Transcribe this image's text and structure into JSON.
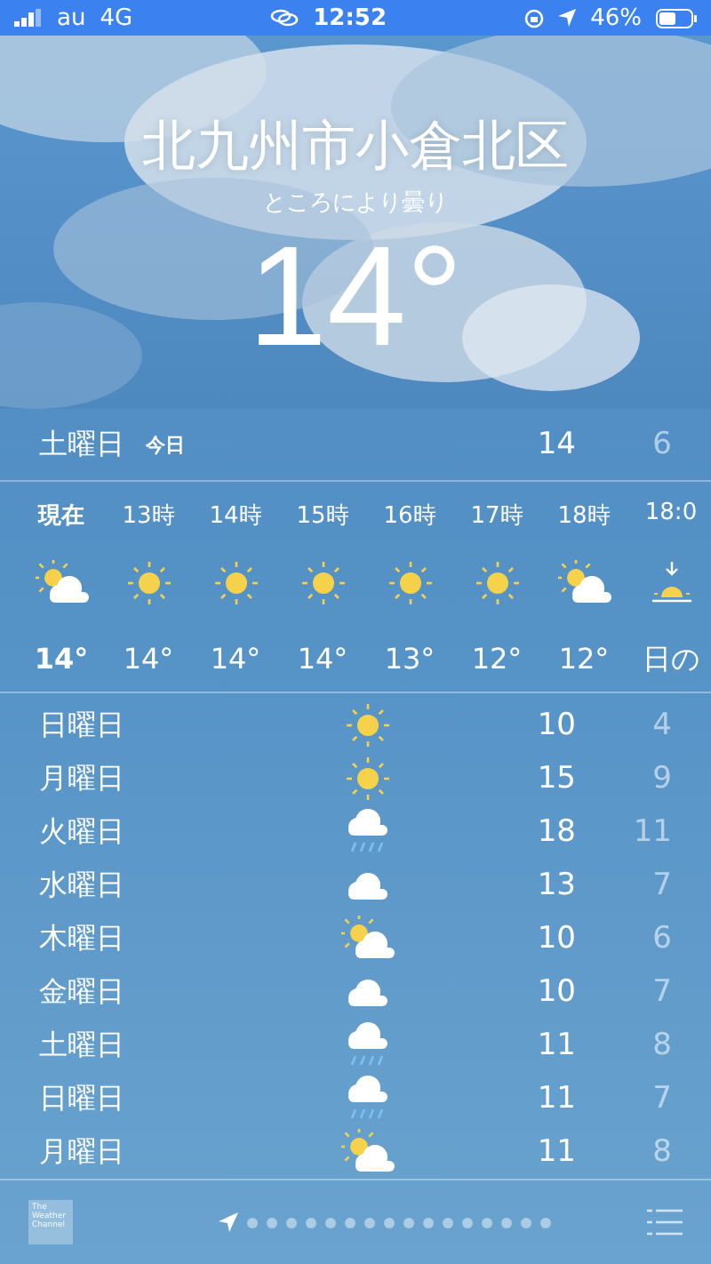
{
  "status_bar": {
    "carrier": "au",
    "network": "4G",
    "time": "12:52",
    "battery": "46%"
  },
  "location": {
    "city": "北九州市小倉北区",
    "condition": "ところにより曇り",
    "temperature": "14°"
  },
  "today": {
    "day": "土曜日",
    "label": "今日",
    "high": "14",
    "low": "6"
  },
  "hourly": [
    {
      "time": "現在",
      "kind": "partly",
      "temp": "14°",
      "current": true
    },
    {
      "time": "13時",
      "kind": "sun",
      "temp": "14°",
      "current": false
    },
    {
      "time": "14時",
      "kind": "sun",
      "temp": "14°",
      "current": false
    },
    {
      "time": "15時",
      "kind": "sun",
      "temp": "14°",
      "current": false
    },
    {
      "time": "16時",
      "kind": "sun",
      "temp": "13°",
      "current": false
    },
    {
      "time": "17時",
      "kind": "sun",
      "temp": "12°",
      "current": false
    },
    {
      "time": "18時",
      "kind": "partly",
      "temp": "12°",
      "current": false
    },
    {
      "time": "18:0",
      "kind": "sunset",
      "temp": "日の",
      "current": false
    }
  ],
  "daily": [
    {
      "day": "日曜日",
      "kind": "sun",
      "high": "10",
      "low": "4"
    },
    {
      "day": "月曜日",
      "kind": "sun",
      "high": "15",
      "low": "9"
    },
    {
      "day": "火曜日",
      "kind": "rain",
      "high": "18",
      "low": "11"
    },
    {
      "day": "水曜日",
      "kind": "cloud",
      "high": "13",
      "low": "7"
    },
    {
      "day": "木曜日",
      "kind": "partly",
      "high": "10",
      "low": "6"
    },
    {
      "day": "金曜日",
      "kind": "cloud",
      "high": "10",
      "low": "7"
    },
    {
      "day": "土曜日",
      "kind": "rain",
      "high": "11",
      "low": "8"
    },
    {
      "day": "日曜日",
      "kind": "rain",
      "high": "11",
      "low": "7"
    },
    {
      "day": "月曜日",
      "kind": "partly",
      "high": "11",
      "low": "8"
    }
  ],
  "footer": {
    "logo_text": "The Weather Channel",
    "pages": [
      {
        "kind": "location",
        "selected": true
      },
      {
        "kind": "dot",
        "selected": false
      },
      {
        "kind": "dot",
        "selected": false
      },
      {
        "kind": "dot",
        "selected": false
      },
      {
        "kind": "dot",
        "selected": false
      },
      {
        "kind": "dot",
        "selected": false
      },
      {
        "kind": "dot",
        "selected": false
      },
      {
        "kind": "dot",
        "selected": false
      },
      {
        "kind": "dot",
        "selected": false
      },
      {
        "kind": "dot",
        "selected": false
      },
      {
        "kind": "dot",
        "selected": false
      },
      {
        "kind": "dot",
        "selected": false
      },
      {
        "kind": "dot",
        "selected": false
      },
      {
        "kind": "dot",
        "selected": false
      },
      {
        "kind": "dot",
        "selected": false
      },
      {
        "kind": "dot",
        "selected": false
      },
      {
        "kind": "dot",
        "selected": false
      }
    ]
  }
}
